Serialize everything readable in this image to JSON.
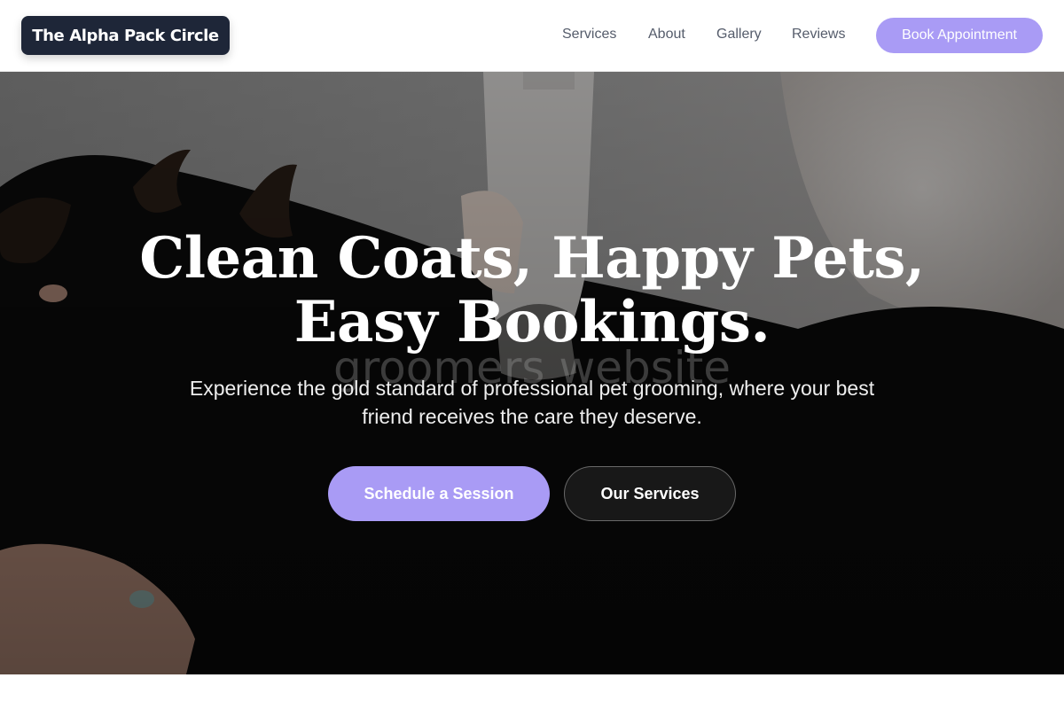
{
  "header": {
    "logo_text": "The Alpha Pack Circle",
    "nav": [
      {
        "label": "Services"
      },
      {
        "label": "About"
      },
      {
        "label": "Gallery"
      },
      {
        "label": "Reviews"
      }
    ],
    "book_button": "Book Appointment"
  },
  "hero": {
    "headline_line1": "Clean Coats, Happy Pets,",
    "headline_line2": "Easy Bookings.",
    "watermark": "groomers website",
    "subtext": "Experience the gold standard of professional pet grooming, where your best friend receives the care they deserve.",
    "primary_cta": "Schedule a Session",
    "secondary_cta": "Our Services"
  },
  "colors": {
    "accent": "#a99bf5",
    "logo_bg": "#1e2638",
    "nav_text": "#555c6b"
  }
}
